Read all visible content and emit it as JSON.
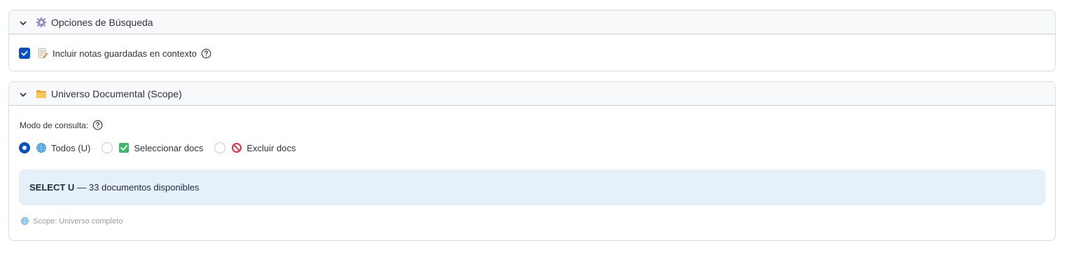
{
  "search_options": {
    "title": "Opciones de Búsqueda",
    "include_notes": {
      "label": "Incluir notas guardadas en contexto",
      "checked": true
    }
  },
  "scope": {
    "title": "Universo Documental (Scope)",
    "mode_label": "Modo de consulta:",
    "options": [
      {
        "label": "Todos (U)",
        "icon": "globe-icon",
        "selected": true
      },
      {
        "label": "Seleccionar docs",
        "icon": "check-box-icon",
        "selected": false
      },
      {
        "label": "Excluir docs",
        "icon": "no-entry-icon",
        "selected": false
      }
    ],
    "info_bold": "SELECT U",
    "info_text": "— 33 documentos disponibles",
    "scope_caption": "Scope: Universo completo"
  },
  "colors": {
    "accent": "#0a4fbf",
    "info_bg": "#e6f0fb",
    "header_bg": "#f8f9fb"
  }
}
